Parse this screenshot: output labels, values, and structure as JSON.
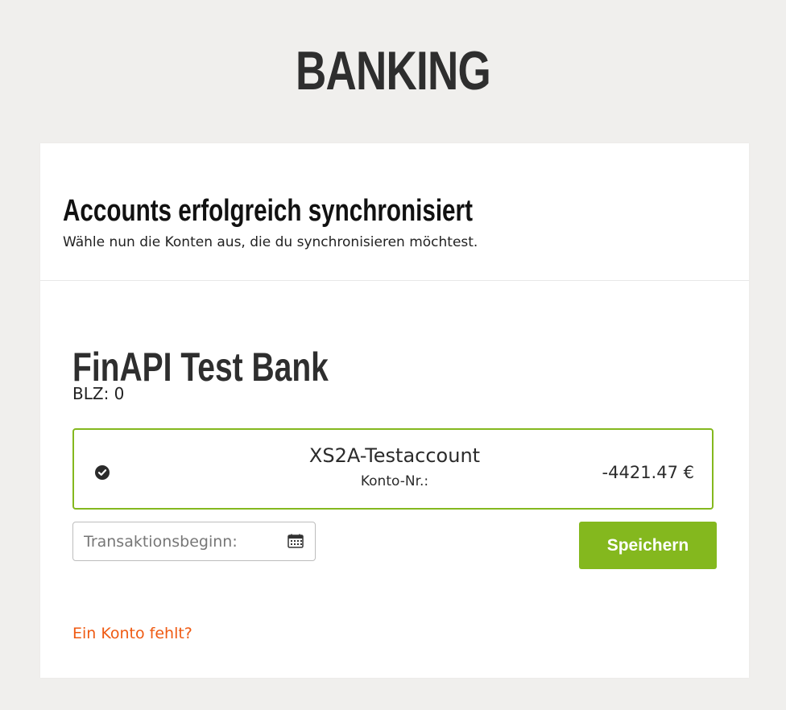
{
  "page": {
    "title": "BANKING"
  },
  "card": {
    "header": {
      "title": "Accounts erfolgreich synchronisiert",
      "subtitle": "Wähle nun die Konten aus, die du synchronisieren möchtest."
    },
    "bank": {
      "name": "FinAPI Test Bank",
      "blz": "BLZ: 0"
    },
    "account": {
      "name": "XS2A-Testaccount",
      "number_label": "Konto-Nr.:",
      "balance": "-4421.47 €",
      "selected": true,
      "check_icon": "check-circle-icon"
    },
    "date_input": {
      "placeholder": "Transaktionsbeginn:",
      "value": "",
      "icon": "calendar-icon"
    },
    "save_button": {
      "label": "Speichern"
    },
    "missing_account_link": {
      "label": "Ein Konto fehlt?"
    }
  },
  "colors": {
    "background": "#f0efed",
    "card": "#ffffff",
    "accent_green": "#84b81e",
    "link_orange": "#ef5a12",
    "text_dark": "#2e2e2e"
  }
}
